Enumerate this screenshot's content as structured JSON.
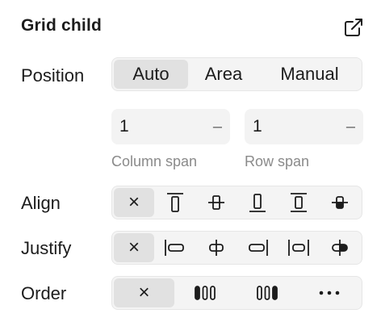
{
  "panel": {
    "title": "Grid child",
    "open_icon": "external-link-icon"
  },
  "position": {
    "label": "Position",
    "options": [
      "Auto",
      "Area",
      "Manual"
    ],
    "selected": "Auto"
  },
  "span": {
    "column": {
      "value": "1",
      "suffix": "–",
      "caption": "Column span"
    },
    "row": {
      "value": "1",
      "suffix": "–",
      "caption": "Row span"
    }
  },
  "align": {
    "label": "Align",
    "options": [
      "×",
      "align-start-icon",
      "align-center-icon",
      "align-end-icon",
      "align-stretch-icon",
      "align-baseline-icon"
    ],
    "selected": "×"
  },
  "justify": {
    "label": "Justify",
    "options": [
      "×",
      "justify-start-icon",
      "justify-center-icon",
      "justify-end-icon",
      "justify-stretch-icon",
      "justify-baseline-icon"
    ],
    "selected": "×"
  },
  "order": {
    "label": "Order",
    "options": [
      "×",
      "order-first-icon",
      "order-last-icon",
      "more-icon"
    ],
    "selected": "×"
  }
}
